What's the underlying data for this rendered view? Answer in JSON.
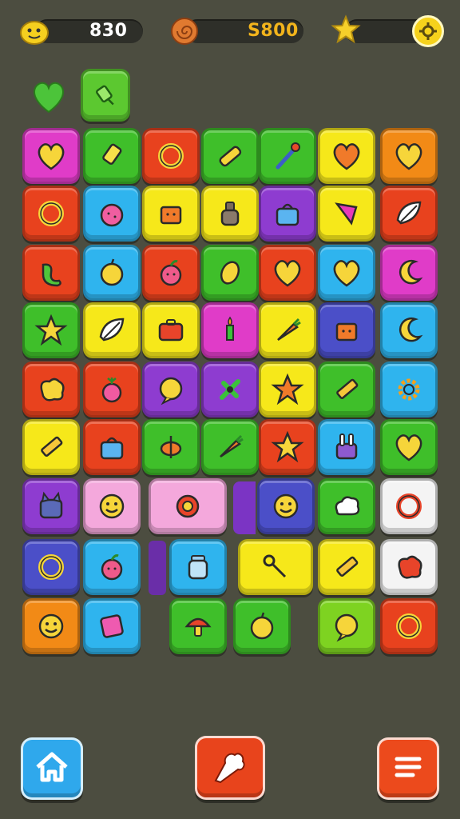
{
  "hud": {
    "moves_value": "830",
    "coins_value": "S800",
    "moves_icon": "yellow-blob-icon",
    "coins_icon": "snail-shell-icon",
    "star_icon": "star-icon",
    "settings_icon": "gear-icon"
  },
  "colors": {
    "background": "#4c4d40",
    "hud_text_white": "#ffffff",
    "hud_text_gold": "#f2b41c",
    "magenta": "#e03cc8",
    "green": "#3fbf2a",
    "red": "#e8421e",
    "yellow": "#f6e81a",
    "blue": "#2fb4ee",
    "purple": "#8e3cd0",
    "orange": "#f28a16",
    "pink": "#f4a8dc",
    "white": "#f4f4f4",
    "lime": "#7ed321",
    "indigo": "#4b4fc8"
  },
  "preview": [
    {
      "icon": "heart-icon",
      "color": "#4cc43a"
    },
    {
      "icon": "candy-icon",
      "color": "#5cc830"
    }
  ],
  "board": [
    [
      {
        "c": "magenta",
        "i": "heart-icon"
      },
      {
        "c": "green",
        "i": "candy-icon"
      },
      {
        "c": "red",
        "i": "ring-icon"
      },
      {
        "c": "green",
        "i": "bar-icon"
      },
      {
        "c": "green",
        "i": "brush-icon"
      },
      {
        "c": "yellow",
        "i": "heart-icon"
      },
      {
        "c": "orange",
        "i": "heart-icon"
      }
    ],
    [
      {
        "c": "red",
        "i": "ring-icon"
      },
      {
        "c": "blue",
        "i": "berry-icon"
      },
      {
        "c": "yellow",
        "i": "box-icon"
      },
      {
        "c": "yellow",
        "i": "bottle-icon"
      },
      {
        "c": "purple",
        "i": "bag-icon"
      },
      {
        "c": "yellow",
        "i": "arrow-icon"
      },
      {
        "c": "red",
        "i": "leaf-icon"
      }
    ],
    [
      {
        "c": "red",
        "i": "bean-icon"
      },
      {
        "c": "blue",
        "i": "fruit-icon"
      },
      {
        "c": "red",
        "i": "apple-icon"
      },
      {
        "c": "green",
        "i": "coin-icon"
      },
      {
        "c": "red",
        "i": "heart-icon"
      },
      {
        "c": "blue",
        "i": "heart-icon"
      },
      {
        "c": "magenta",
        "i": "moon-icon"
      }
    ],
    [
      {
        "c": "green",
        "i": "star-icon"
      },
      {
        "c": "yellow",
        "i": "leaf-icon"
      },
      {
        "c": "yellow",
        "i": "case-icon"
      },
      {
        "c": "magenta",
        "i": "candle-icon"
      },
      {
        "c": "yellow",
        "i": "carrot-icon"
      },
      {
        "c": "indigo",
        "i": "box-icon"
      },
      {
        "c": "blue",
        "i": "moon-icon"
      }
    ],
    [
      {
        "c": "red",
        "i": "blob-icon"
      },
      {
        "c": "red",
        "i": "radish-icon"
      },
      {
        "c": "purple",
        "i": "bubble-icon"
      },
      {
        "c": "purple",
        "i": "pin-icon"
      },
      {
        "c": "yellow",
        "i": "star-icon"
      },
      {
        "c": "green",
        "i": "crayon-icon"
      },
      {
        "c": "blue",
        "i": "gear-icon"
      }
    ],
    [
      {
        "c": "yellow",
        "i": "crayon-icon"
      },
      {
        "c": "red",
        "i": "bag-icon"
      },
      {
        "c": "green",
        "i": "top-icon"
      },
      {
        "c": "green",
        "i": "carrot-icon"
      },
      {
        "c": "red",
        "i": "star-icon"
      },
      {
        "c": "blue",
        "i": "bunny-icon"
      },
      {
        "c": "green",
        "i": "heart-icon"
      }
    ],
    [
      {
        "c": "purple",
        "i": "cat-icon"
      },
      {
        "c": "pink",
        "i": "smiley-icon"
      },
      {
        "c": "pink",
        "i": "flower-icon"
      },
      {
        "c": "indigo",
        "i": "smiley-icon"
      },
      {
        "c": "green",
        "i": "cloud-icon"
      },
      {
        "c": "white",
        "i": "ring-icon"
      }
    ],
    [
      {
        "c": "indigo",
        "i": "ring-icon"
      },
      {
        "c": "blue",
        "i": "apple-icon"
      },
      {
        "c": "blue",
        "i": "jar-icon"
      },
      {
        "c": "yellow",
        "i": "key-icon"
      },
      {
        "c": "yellow",
        "i": "crayon-icon"
      },
      {
        "c": "white",
        "i": "blob-icon"
      }
    ],
    [
      {
        "c": "orange",
        "i": "smiley-icon"
      },
      {
        "c": "blue",
        "i": "square-icon"
      },
      {
        "c": "green",
        "i": "mushroom-icon"
      },
      {
        "c": "green",
        "i": "fruit-icon"
      },
      {
        "c": "lime",
        "i": "bubble-icon"
      },
      {
        "c": "red",
        "i": "ring-icon"
      }
    ]
  ],
  "bottom_bar": {
    "home_icon": "home-icon",
    "hint_icon": "hint-hand-icon",
    "menu_icon": "menu-icon"
  }
}
